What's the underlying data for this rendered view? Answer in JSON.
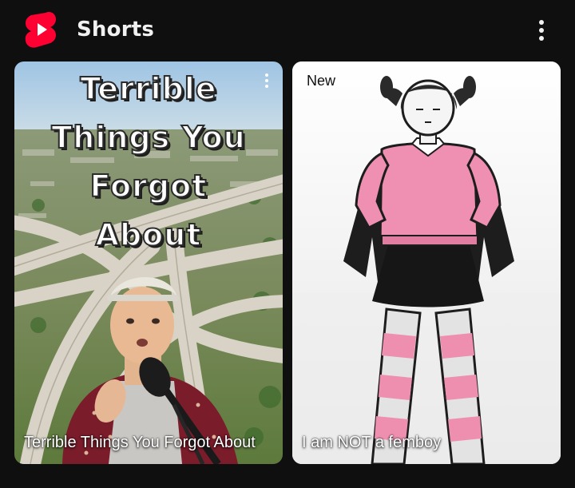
{
  "header": {
    "title": "Shorts",
    "logo_icon": "youtube-shorts-logo-icon",
    "menu_icon": "more-vertical-icon",
    "brand_color": "#ff0033"
  },
  "shorts": [
    {
      "thumbnail_title": "Terrible\nThings You\nForgot\nAbout",
      "caption": "Terrible Things You Forgot About",
      "menu_icon": "more-vertical-icon"
    },
    {
      "badge": "New",
      "caption": "I am NOT a femboy"
    }
  ]
}
